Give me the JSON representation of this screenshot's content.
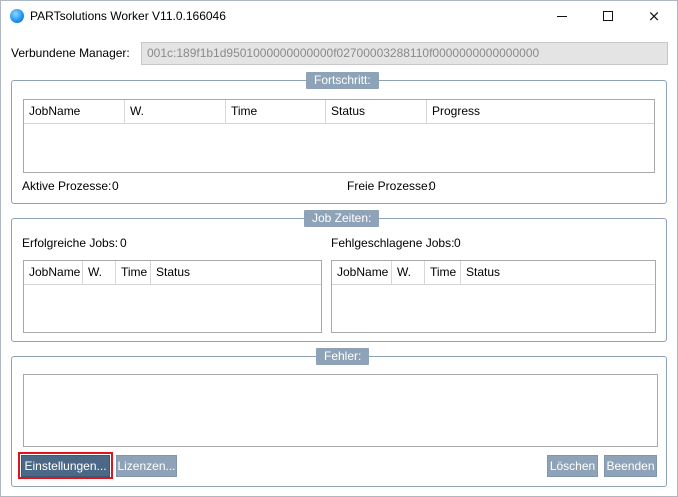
{
  "window": {
    "title": "PARTsolutions Worker V11.0.166046",
    "controls": {
      "minimize": "minimize",
      "maximize": "maximize",
      "close": "×"
    }
  },
  "manager": {
    "label": "Verbundene Manager:",
    "value": "001c:189f1b1d9501000000000000f02700003288110f0000000000000000"
  },
  "progress_group": {
    "title": "Fortschritt:",
    "columns": [
      "JobName",
      "W.",
      "Time",
      "Status",
      "Progress"
    ],
    "active_label": "Aktive Prozesse:",
    "active_value": "0",
    "free_label": "Freie Prozesse:",
    "free_value": "0"
  },
  "jobtimes_group": {
    "title": "Job Zeiten:",
    "success_label": "Erfolgreiche Jobs:",
    "success_value": "0",
    "failed_label": "Fehlgeschlagene Jobs:",
    "failed_value": "0",
    "success_columns": [
      "JobName",
      "W.",
      "Time",
      "Status"
    ],
    "failed_columns": [
      "JobName",
      "W.",
      "Time",
      "Status"
    ]
  },
  "error_group": {
    "title": "Fehler:",
    "buttons": {
      "settings": "Einstellungen...",
      "licenses": "Lizenzen...",
      "delete": "Löschen",
      "quit": "Beenden"
    }
  },
  "colors": {
    "group_header": "#8ea3b7",
    "primary_button": "#4b6886",
    "focus_highlight": "#e0141e"
  }
}
